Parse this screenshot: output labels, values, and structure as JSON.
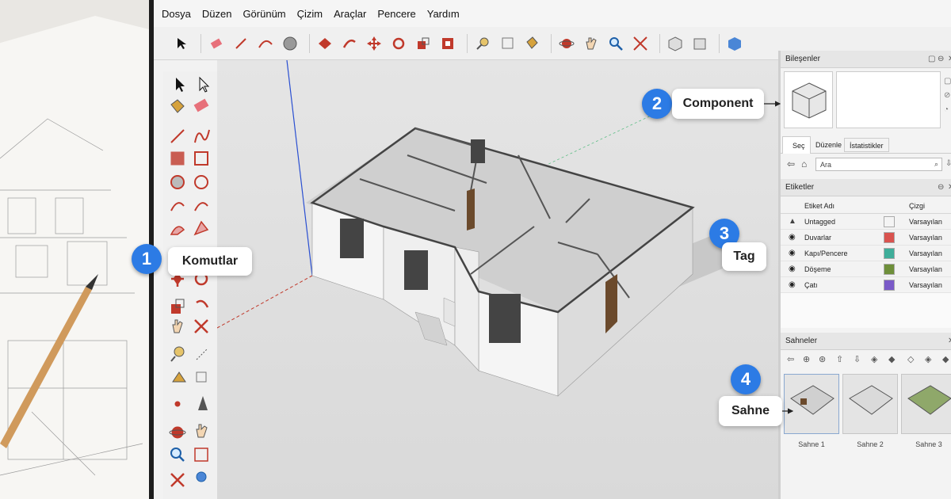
{
  "menu": [
    "Dosya",
    "Düzen",
    "Görünüm",
    "Çizim",
    "Araçlar",
    "Pencere",
    "Yardım"
  ],
  "panels": {
    "components": {
      "title": "Bileşenler",
      "tabs": [
        "Seç",
        "Düzenle",
        "İstatistikler"
      ],
      "search_placeholder": "Ara"
    },
    "tags": {
      "title": "Etiketler",
      "col_name": "Etiket Adı",
      "col_line": "Çizgi",
      "rows": [
        {
          "name": "Untagged",
          "color": "#f4f4f4",
          "line": "Varsayılan"
        },
        {
          "name": "Duvarlar",
          "color": "#d9534f",
          "line": "Varsayılan"
        },
        {
          "name": "Kapı/Pencere",
          "color": "#3fae9a",
          "line": "Varsayılan"
        },
        {
          "name": "Döşeme",
          "color": "#6e8f3a",
          "line": "Varsayılan"
        },
        {
          "name": "Çatı",
          "color": "#7a5ac8",
          "line": "Varsayılan"
        }
      ]
    },
    "scenes": {
      "title": "Sahneler",
      "items": [
        "Sahne 1",
        "Sahne 2",
        "Sahne 3"
      ]
    }
  },
  "callouts": [
    {
      "number": "1",
      "label": "Komutlar"
    },
    {
      "number": "2",
      "label": "Component"
    },
    {
      "number": "3",
      "label": "Tag"
    },
    {
      "number": "4",
      "label": "Sahne"
    }
  ],
  "colors": {
    "accent": "#2c7be5",
    "axis_red": "#c0392b",
    "axis_green": "#27ae60",
    "axis_blue": "#2a4fd1"
  }
}
